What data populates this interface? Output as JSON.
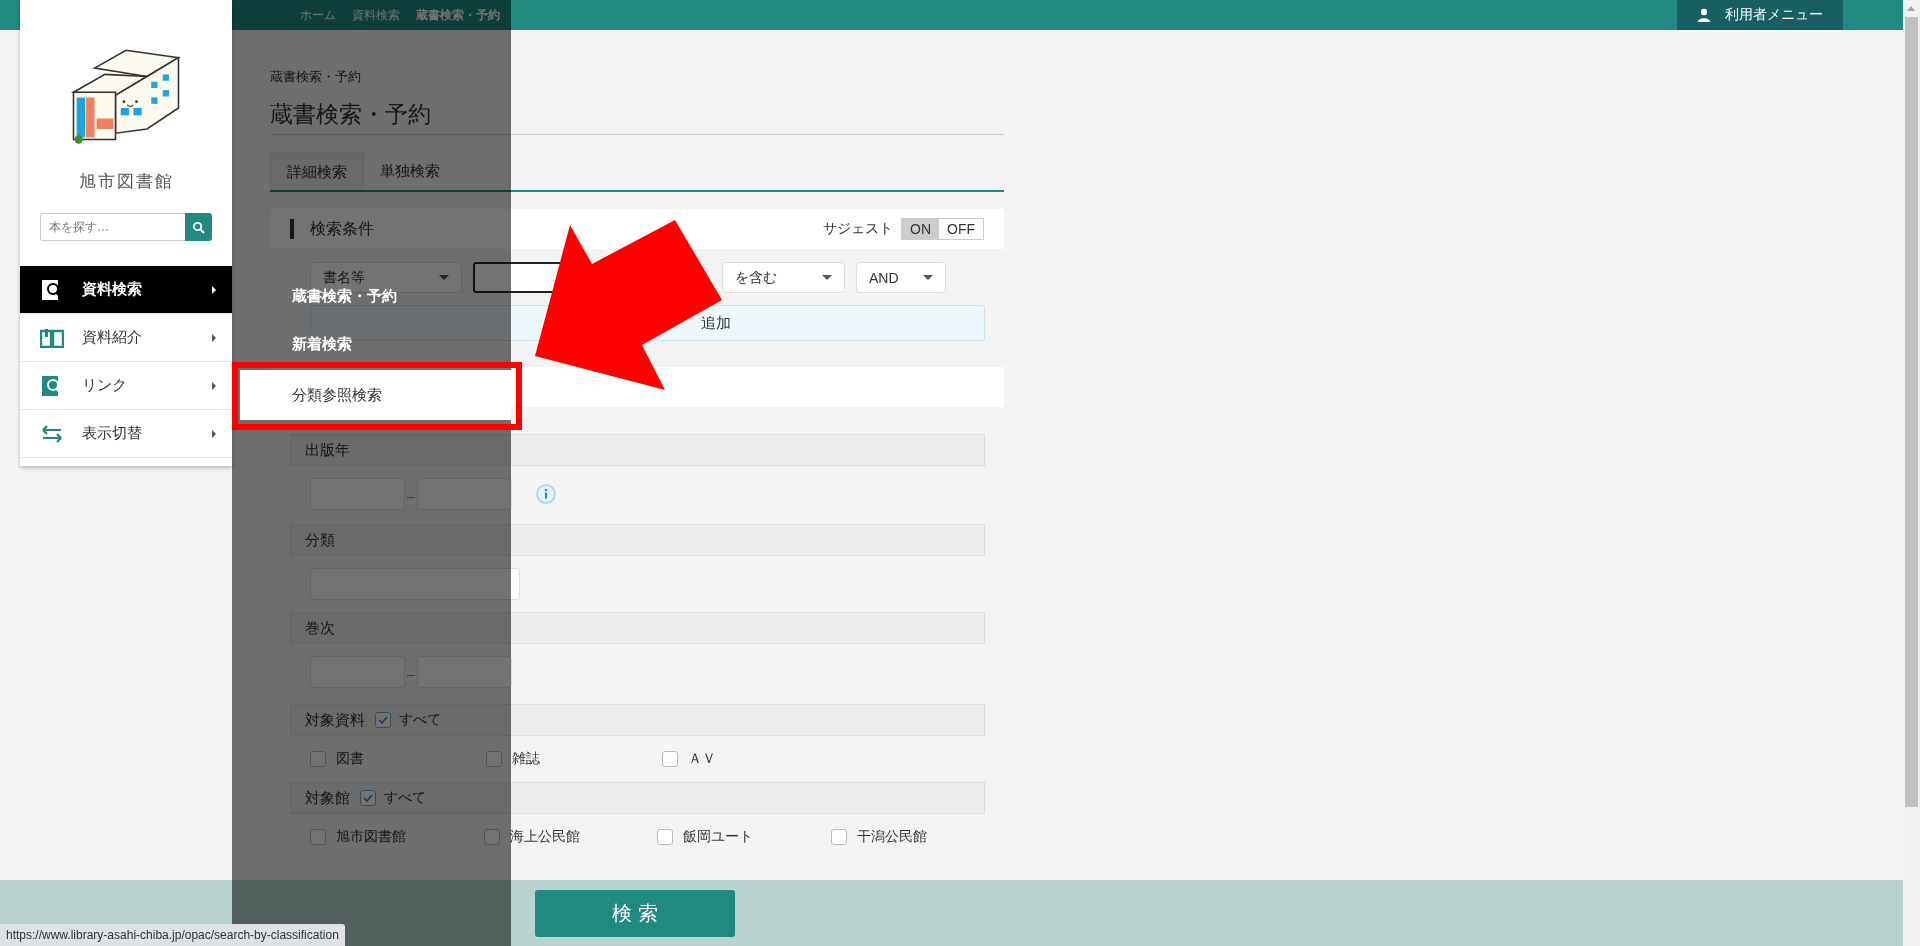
{
  "top_bar": {
    "breadcrumbs": [
      {
        "label": "ホーム"
      },
      {
        "label": "資料検索"
      },
      {
        "label": "蔵書検索・予約"
      }
    ],
    "user_menu": "利用者メニュー"
  },
  "sidebar": {
    "library_name": "旭市図書館",
    "search": {
      "placeholder": "本を探す…"
    },
    "items": [
      {
        "label": "資料検索",
        "selected": true
      },
      {
        "label": "資料紹介",
        "selected": false
      },
      {
        "label": "リンク",
        "selected": false
      },
      {
        "label": "表示切替",
        "selected": false
      }
    ]
  },
  "submenu": {
    "items": [
      {
        "label": "蔵書検索・予約",
        "selected": false
      },
      {
        "label": "新着検索",
        "selected": false
      },
      {
        "label": "分類参照検索",
        "selected": true
      }
    ]
  },
  "page": {
    "breadcrumb": "蔵書検索・予約",
    "title": "蔵書検索・予約",
    "tabs": [
      {
        "label": "詳細検索",
        "selected": true
      },
      {
        "label": "単独検索",
        "selected": false
      }
    ],
    "conditions": {
      "title": "検索条件",
      "suggest": {
        "label": "サジェスト",
        "options": [
          {
            "label": "ON",
            "selected": true
          },
          {
            "label": "OFF",
            "selected": false
          }
        ]
      },
      "field_select": "書名等",
      "match_select": "を含む",
      "operator_select": "AND",
      "add_row": "追加"
    },
    "publication_year": {
      "label": "出版年"
    },
    "classification": {
      "label": "分類"
    },
    "volume": {
      "label": "巻次"
    },
    "material_types": {
      "label": "対象資料",
      "all": {
        "label": "すべて",
        "checked": true
      },
      "options": [
        {
          "label": "図書",
          "checked": false
        },
        {
          "label": "雑誌",
          "checked": false
        },
        {
          "label": "ＡＶ",
          "checked": false
        }
      ]
    },
    "libraries": {
      "label": "対象館",
      "all": {
        "label": "すべて",
        "checked": true
      },
      "options": [
        {
          "label": "旭市図書館",
          "checked": false
        },
        {
          "label": "海上公民館",
          "checked": false
        },
        {
          "label": "飯岡ユート",
          "checked": false
        },
        {
          "label": "干潟公民館",
          "checked": false
        }
      ]
    }
  },
  "search_button": "検 索",
  "status_url": "https://www.library-asahi-chiba.jp/opac/search-by-classification"
}
